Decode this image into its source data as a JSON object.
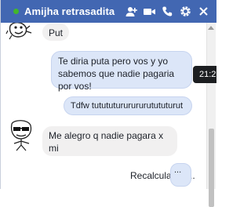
{
  "header": {
    "title": "Amijha retrasadita",
    "status_color": "#42b72a",
    "bar_color": "#4267b2",
    "icons": [
      "add-user-icon",
      "video-call-icon",
      "phone-icon",
      "gear-icon",
      "close-icon"
    ]
  },
  "messages": [
    {
      "sender": "other",
      "text": "Put"
    },
    {
      "sender": "me",
      "text": "Te diria puta pero vos y yo sabemos que nadie pagaria por vos!"
    },
    {
      "sender": "me",
      "text": "Tdfw tutututururururutututurut"
    },
    {
      "sender": "other",
      "text": "Me alegro q nadie  pagara x mi"
    },
    {
      "sender": "me",
      "text": "Recalculando..."
    }
  ],
  "tooltip": {
    "time": "21:2"
  }
}
